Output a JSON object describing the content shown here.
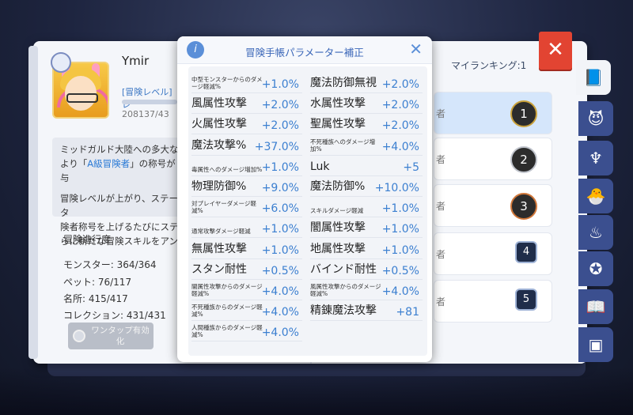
{
  "player": {
    "name": "Ymir",
    "level_label": "[冒険レベル]レ",
    "exp_text": "208137/43"
  },
  "description": {
    "line1": "ミッドガルド大陸への多大な",
    "line2_pre": "より「",
    "line2_hl": "A級冒険者",
    "line2_post": "」の称号が与",
    "line3": "冒険レベルが上がり、ステータ",
    "line4": "険者称号を上げるたびにステ",
    "line5": "らに新たな冒険スキルをアン"
  },
  "progress": {
    "title": "冒険進行度",
    "items": [
      {
        "label": "モンスター: 364/364"
      },
      {
        "label": "ペット: 76/117"
      },
      {
        "label": "名所: 415/417"
      },
      {
        "label": "コレクション: 431/431"
      }
    ]
  },
  "one_tap_button": {
    "label": "ワンタップ有効化"
  },
  "ranking": {
    "label": "マイランキング:1",
    "rows": [
      {
        "text": "者",
        "rank": "1"
      },
      {
        "text": "者",
        "rank": "2"
      },
      {
        "text": "者",
        "rank": "3"
      },
      {
        "text": "者",
        "rank": "4"
      },
      {
        "text": "者",
        "rank": "5"
      }
    ]
  },
  "close_button": {
    "label": "✕"
  },
  "side_tabs": [
    {
      "icon": "book-icon",
      "glyph": "📘"
    },
    {
      "icon": "monster-face-icon",
      "glyph": "😈"
    },
    {
      "icon": "horns-icon",
      "glyph": "♆"
    },
    {
      "icon": "pet-icon",
      "glyph": "🐣"
    },
    {
      "icon": "chef-hat-icon",
      "glyph": "♨"
    },
    {
      "icon": "medal-icon",
      "glyph": "✪"
    },
    {
      "icon": "open-book-icon",
      "glyph": "📖"
    },
    {
      "icon": "card-icon",
      "glyph": "▣"
    }
  ],
  "modal": {
    "title": "冒険手帳パラメーター補正",
    "info_icon": "i",
    "close_icon": "✕",
    "stats_left": [
      {
        "name": "中型モンスターからのダメージ軽減%",
        "value": "+1.0%",
        "small": true
      },
      {
        "name": "風属性攻撃",
        "value": "+2.0%"
      },
      {
        "name": "火属性攻撃",
        "value": "+2.0%"
      },
      {
        "name": "魔法攻撃%",
        "value": "+37.0%"
      },
      {
        "name": "毒属性へのダメージ増加%",
        "value": "+1.0%",
        "small": true
      },
      {
        "name": "物理防御%",
        "value": "+9.0%"
      },
      {
        "name": "対プレイヤーダメージ軽減%",
        "value": "+6.0%",
        "small": true
      },
      {
        "name": "通常攻撃ダメージ軽減",
        "value": "+1.0%",
        "small": true
      },
      {
        "name": "無属性攻撃",
        "value": "+1.0%"
      },
      {
        "name": "スタン耐性",
        "value": "+0.5%"
      },
      {
        "name": "闇属性攻撃からのダメージ軽減%",
        "value": "+4.0%",
        "small": true
      },
      {
        "name": "不死種族からのダメージ軽減%",
        "value": "+4.0%",
        "small": true
      },
      {
        "name": "人間種族からのダメージ軽減%",
        "value": "+4.0%",
        "small": true
      }
    ],
    "stats_right": [
      {
        "name": "魔法防御無視",
        "value": "+2.0%"
      },
      {
        "name": "水属性攻撃",
        "value": "+2.0%"
      },
      {
        "name": "聖属性攻撃",
        "value": "+2.0%"
      },
      {
        "name": "不死種族へのダメージ増加%",
        "value": "+4.0%",
        "small": true
      },
      {
        "name": "Luk",
        "value": "+5"
      },
      {
        "name": "魔法防御%",
        "value": "+10.0%"
      },
      {
        "name": "スキルダメージ軽減",
        "value": "+1.0%",
        "small": true
      },
      {
        "name": "闇属性攻撃",
        "value": "+1.0%"
      },
      {
        "name": "地属性攻撃",
        "value": "+1.0%"
      },
      {
        "name": "バインド耐性",
        "value": "+0.5%"
      },
      {
        "name": "風属性攻撃からのダメージ軽減%",
        "value": "+4.0%",
        "small": true
      },
      {
        "name": "精錬魔法攻撃",
        "value": "+81"
      }
    ]
  }
}
